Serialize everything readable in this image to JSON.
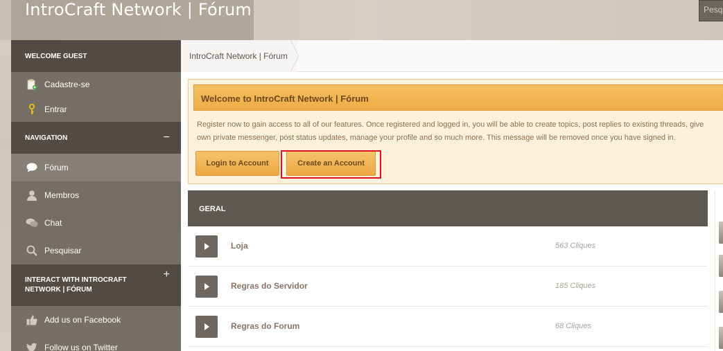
{
  "header": {
    "site_title": "IntroCraft Network | Fórum",
    "search_placeholder": "Pesquisar"
  },
  "sidebar": {
    "welcome_heading": "WELCOME GUEST",
    "guest_items": [
      {
        "label": "Cadastre-se",
        "icon": "clipboard-add-icon"
      },
      {
        "label": "Entrar",
        "icon": "key-icon"
      }
    ],
    "navigation_heading": "NAVIGATION",
    "navigation_toggle": "−",
    "nav_items": [
      {
        "label": "Fórum",
        "icon": "speech-bubble-icon",
        "active": true
      },
      {
        "label": "Membros",
        "icon": "user-icon"
      },
      {
        "label": "Chat",
        "icon": "chat-bubbles-icon"
      },
      {
        "label": "Pesquisar",
        "icon": "search-icon"
      }
    ],
    "interact_heading": "INTERACT WITH INTROCRAFT NETWORK | FÓRUM",
    "interact_toggle": "+",
    "interact_items": [
      {
        "label": "Add us on Facebook",
        "icon": "thumbs-up-icon"
      },
      {
        "label": "Follow us on Twitter",
        "icon": "twitter-bird-icon"
      }
    ]
  },
  "breadcrumb": {
    "current": "IntroCraft Network | Fórum"
  },
  "welcome_notice": {
    "title": "Welcome to IntroCraft Network | Fórum",
    "line1": "Register now to gain access to all of our features. Once registered and logged in, you will be able to create topics, post replies to existing threads, give",
    "line2": "own private messenger, post status updates, manage your profile and so much more. This message will be removed once you have signed in.",
    "login_button": "Login to Account",
    "create_button": "Create an Account"
  },
  "category": {
    "title": "GERAL",
    "forums": [
      {
        "name": "Loja",
        "clicks": "563 Cliques"
      },
      {
        "name": "Regras do Servidor",
        "clicks": "185 Cliques"
      },
      {
        "name": "Regras do Forum",
        "clicks": "68 Cliques"
      }
    ]
  },
  "colors": {
    "accent_orange": "#eeac45",
    "highlight_red": "#e0101e",
    "sidebar_dark": "#524b45"
  }
}
